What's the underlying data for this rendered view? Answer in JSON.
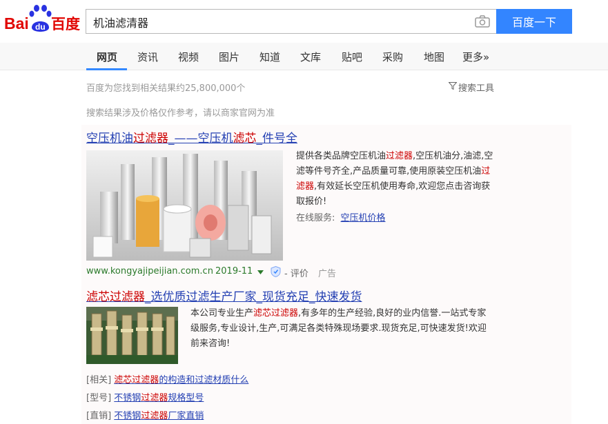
{
  "logo": {
    "left_text": "Bai",
    "paw_text": "du",
    "right_text": "百度"
  },
  "search": {
    "query": "机油滤清器",
    "button_label": "百度一下"
  },
  "nav": {
    "tabs": [
      "网页",
      "资讯",
      "视频",
      "图片",
      "知道",
      "文库",
      "贴吧",
      "采购",
      "地图",
      "更多»"
    ]
  },
  "stats": {
    "result_count_text": "百度为您找到相关结果约25,800,000个",
    "tools_label": "搜索工具"
  },
  "notice": "搜索结果涉及价格仅作参考，请以商家官网为准",
  "results": [
    {
      "title_parts": [
        "空压机油",
        "过滤器",
        "_——空压机",
        "滤芯",
        "_件号全"
      ],
      "desc_parts": [
        "提供各类品牌空压机油",
        "过滤器",
        ",空压机油分,油滤,空滤等件号齐全,产品质量可靠,使用原装空压机油",
        "过滤器",
        ",有效延长空压机使用寿命,欢迎您点击咨询获取报价!"
      ],
      "service_label": "在线服务:",
      "service_link": "空压机价格",
      "url": "www.kongyajipeijian.com.cn",
      "date": "2019-11",
      "rating_link": "- 评价",
      "ad_label": "广告"
    },
    {
      "title_parts": [
        "滤芯过滤器",
        "_选优质过滤生产厂家_现货充足_快速发货"
      ],
      "desc_parts": [
        "本公司专业生产",
        "滤芯过滤器",
        ",有多年的生产经验,良好的业内信誉.一站式专家级服务,专业设计,生产,可满足各类特殊现场要求.现货充足,可快速发货!欢迎前来咨询!"
      ],
      "sub_links": [
        {
          "tag": "[相关]",
          "parts": [
            "滤芯过滤器",
            "的构造和过滤材质什么"
          ]
        },
        {
          "tag": "[型号]",
          "parts": [
            "不锈钢",
            "过滤器",
            "规格型号"
          ]
        },
        {
          "tag": "[直销]",
          "parts": [
            "不锈钢",
            "过滤器",
            "厂家直销"
          ]
        }
      ]
    }
  ],
  "colors": {
    "brand_blue": "#3385ff",
    "brand_red": "#e10602",
    "link_blue": "#2440b3",
    "highlight_red": "#c00",
    "url_green": "#2b7a2b"
  },
  "icons": [
    "baidu-logo",
    "camera-icon",
    "filter-icon",
    "baidu-protect-icon",
    "dropdown-arrow-icon"
  ]
}
